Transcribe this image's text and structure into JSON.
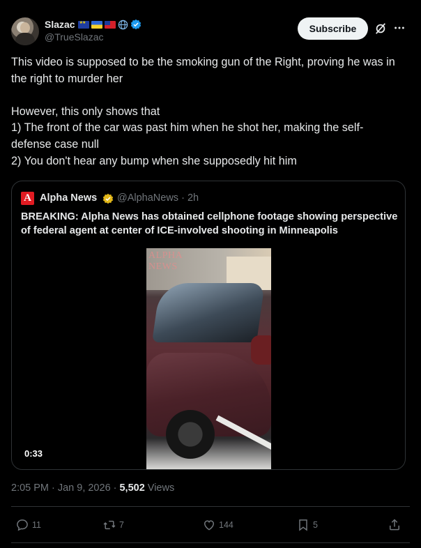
{
  "author": {
    "display_name": "Slazac",
    "handle": "@TrueSlazac",
    "badges": [
      "eu-flag-icon",
      "ukraine-flag-icon",
      "taiwan-flag-icon",
      "globe-icon",
      "verified-badge-icon"
    ]
  },
  "header": {
    "subscribe_label": "Subscribe"
  },
  "post": {
    "text": "This video is supposed to be the smoking gun of the Right, proving he was in the right to murder her\n\nHowever, this only shows that\n1) The front of the car was past him when he shot her, making the self-defense case null\n2) You don't hear any bump when she supposedly hit him"
  },
  "quote": {
    "display_name": "Alpha News",
    "handle_time": "@AlphaNews · 2h",
    "text": "BREAKING: Alpha News has obtained cellphone footage showing perspective of federal agent at center of ICE-involved shooting in Minneapolis",
    "video_watermark_line1": "ALPHA",
    "video_watermark_line2": "NEWS",
    "video_duration": "0:33"
  },
  "meta": {
    "time": "2:05 PM",
    "date": "Jan 9, 2026",
    "views_count": "5,502",
    "views_label": "Views"
  },
  "actions": {
    "replies": "11",
    "reposts": "7",
    "likes": "144",
    "bookmarks": "5"
  },
  "colors": {
    "background": "#000000",
    "text_primary": "#e7e9ea",
    "text_secondary": "#71767b",
    "border": "#2f3336",
    "verified_blue": "#1d9bf0",
    "verified_gold": "#e2b719",
    "alpha_news_red": "#e11b22"
  }
}
